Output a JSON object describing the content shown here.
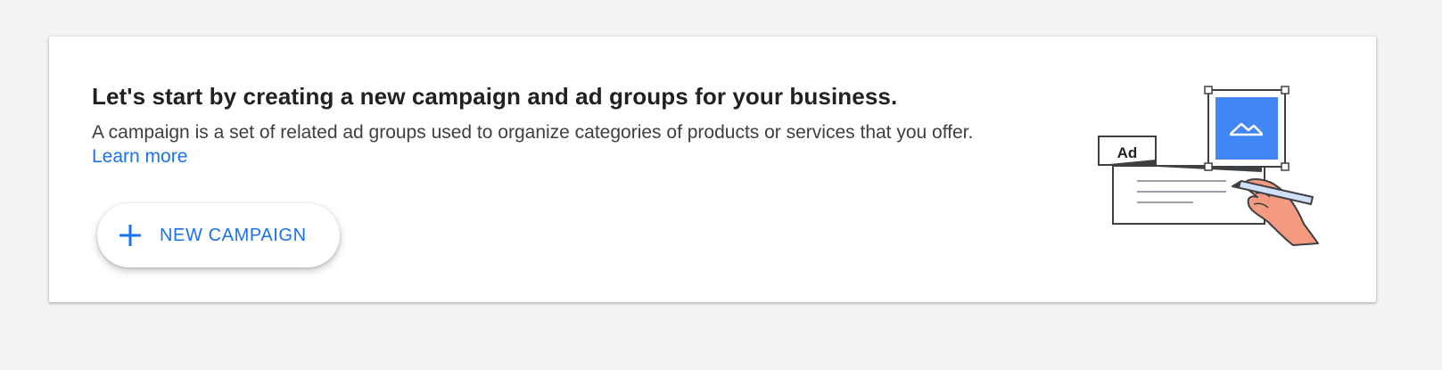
{
  "banner": {
    "headline": "Let's start by creating a new campaign and ad groups for your business.",
    "description": "A campaign is a set of related ad groups used to organize categories of products or services that you offer.",
    "learn_more_label": "Learn more",
    "new_campaign_button": {
      "label": "NEW CAMPAIGN",
      "icon": "plus-icon"
    },
    "illustration": {
      "ad_tag_label": "Ad",
      "icon": "ad-creation-illustration"
    }
  },
  "colors": {
    "page_background": "#f1f3f4",
    "card_background": "#ffffff",
    "accent_blue": "#1a73e8",
    "image_blue": "#4285f4",
    "hand_skin": "#f49a80"
  }
}
